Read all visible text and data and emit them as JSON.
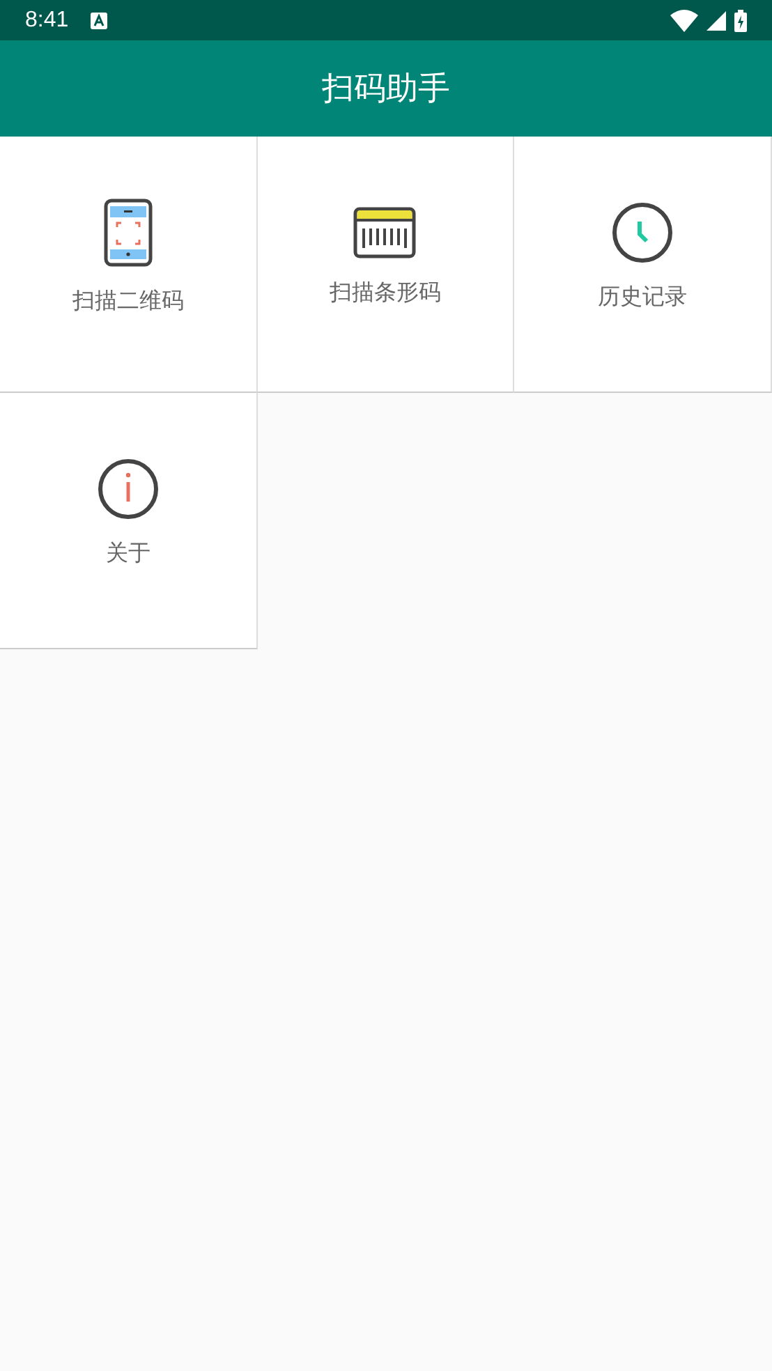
{
  "status_bar": {
    "time": "8:41"
  },
  "app_bar": {
    "title": "扫码助手"
  },
  "tiles": [
    {
      "kind": "qrcode",
      "label": "扫描二维码"
    },
    {
      "kind": "barcode",
      "label": "扫描条形码"
    },
    {
      "kind": "history",
      "label": "历史记录"
    },
    {
      "kind": "about",
      "label": "关于"
    }
  ]
}
